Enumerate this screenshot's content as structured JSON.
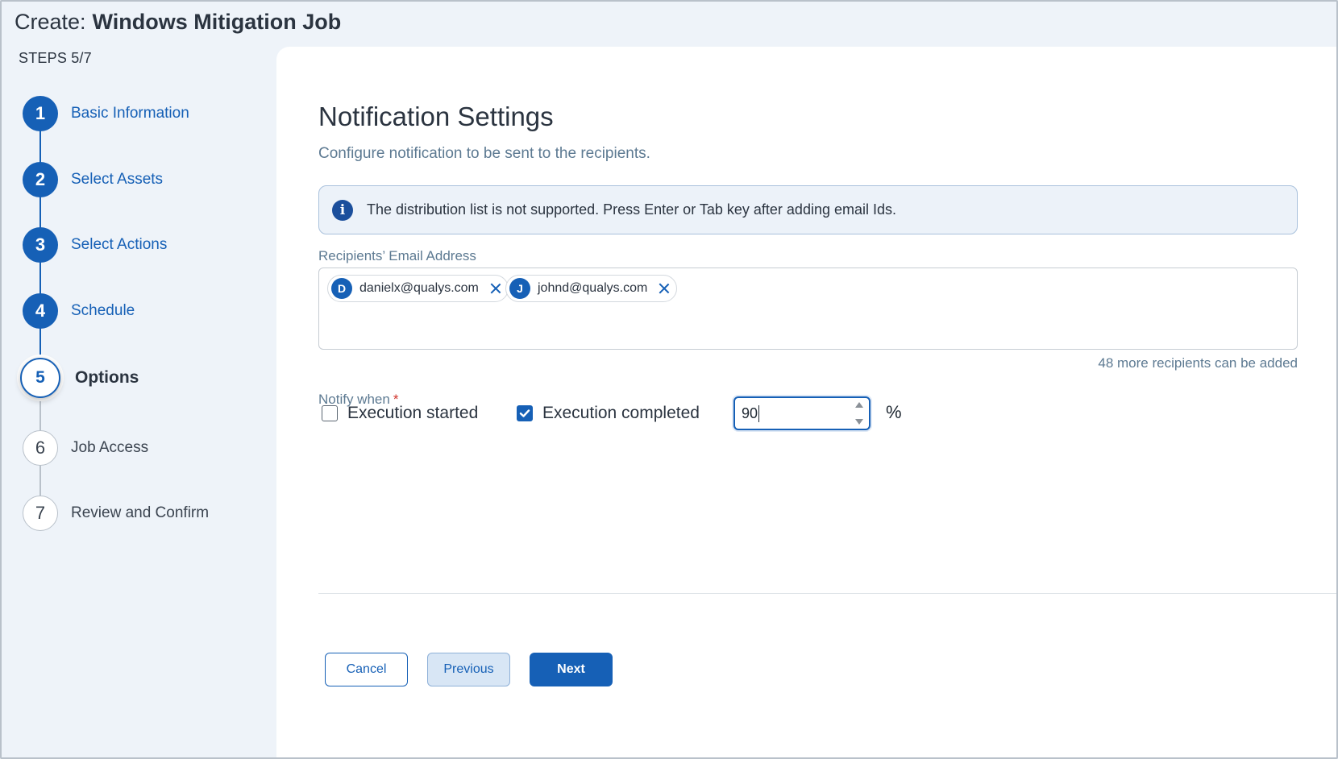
{
  "header": {
    "prefix": "Create:",
    "job_name": "Windows Mitigation Job",
    "steps_counter": "STEPS 5/7"
  },
  "stepper": {
    "steps": [
      {
        "number": "1",
        "label": "Basic Information",
        "state": "done"
      },
      {
        "number": "2",
        "label": "Select Assets",
        "state": "done"
      },
      {
        "number": "3",
        "label": "Select Actions",
        "state": "done"
      },
      {
        "number": "4",
        "label": "Schedule",
        "state": "done"
      },
      {
        "number": "5",
        "label": "Options",
        "state": "active"
      },
      {
        "number": "6",
        "label": "Job Access",
        "state": "todo"
      },
      {
        "number": "7",
        "label": "Review and Confirm",
        "state": "todo"
      }
    ]
  },
  "main": {
    "title": "Notification Settings",
    "subtitle": "Configure notification to be sent to the recipients.",
    "info_banner": {
      "icon": "info-icon",
      "text": "The distribution list is not supported. Press Enter or Tab key after adding email Ids."
    },
    "recipients": {
      "label": "Recipients’ Email Address",
      "chips": [
        {
          "initial": "D",
          "email": "danielx@qualys.com"
        },
        {
          "initial": "J",
          "email": "johnd@qualys.com"
        }
      ],
      "remaining_text": "48 more recipients can be added"
    },
    "notify": {
      "label": "Notify when",
      "required_mark": "*",
      "execution_started": {
        "label": "Execution started",
        "checked": false
      },
      "execution_completed": {
        "label": "Execution completed",
        "checked": true
      },
      "percent_value": "90",
      "percent_unit": "%"
    }
  },
  "footer": {
    "cancel_label": "Cancel",
    "previous_label": "Previous",
    "next_label": "Next"
  },
  "colors": {
    "accent": "#1660b6",
    "page_bg": "#eef3f9",
    "required": "#d0342c"
  }
}
